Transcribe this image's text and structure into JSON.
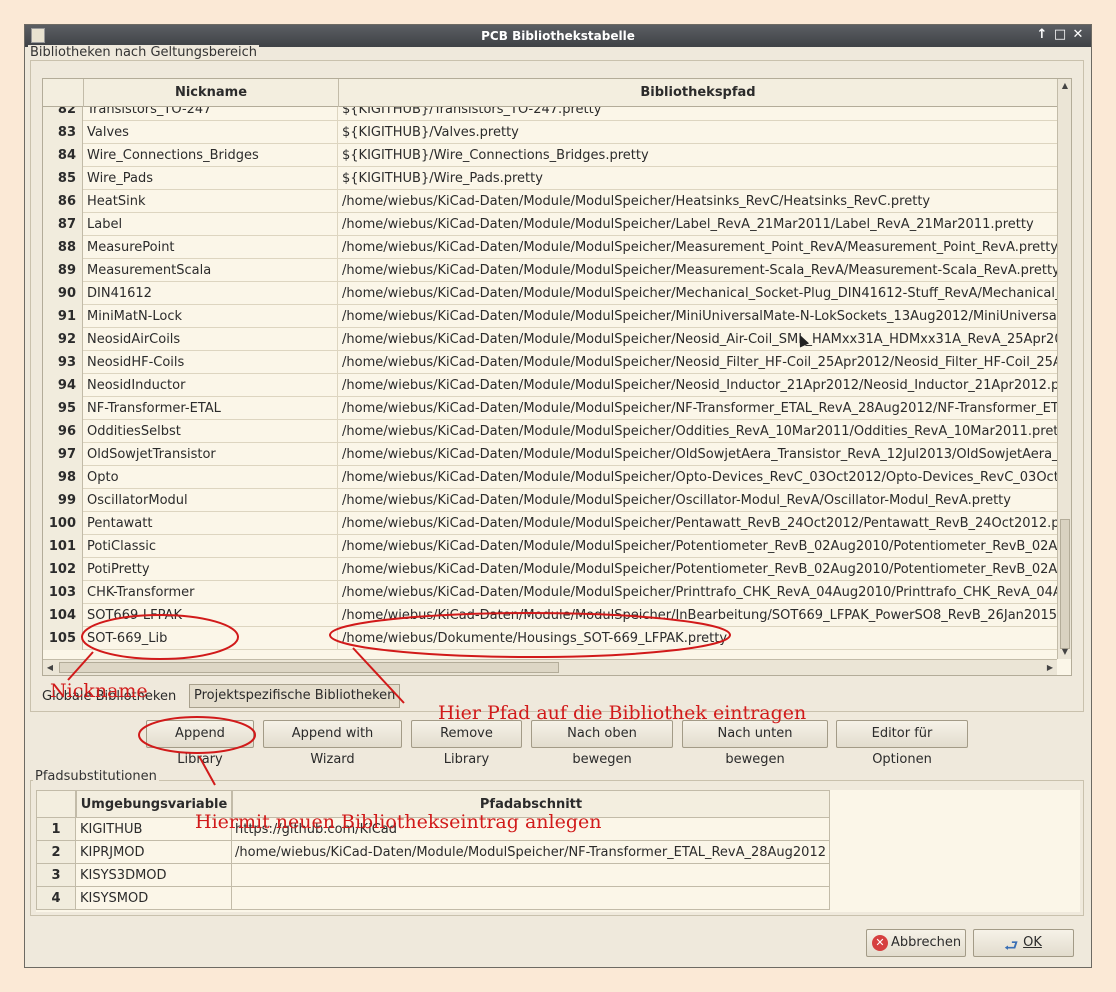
{
  "window": {
    "title": "PCB Bibliothekstabelle"
  },
  "groups": {
    "scope": "Bibliotheken nach Geltungsbereich",
    "substitutions": "Pfadsubstitutionen"
  },
  "lib_table": {
    "columns": [
      "Nickname",
      "Bibliothekspfad"
    ],
    "partial_row": {
      "num": "82",
      "nick": "Transistors_TO-247",
      "path": "${KIGITHUB}/Transistors_TO-247.pretty"
    },
    "rows": [
      {
        "num": "83",
        "nick": "Valves",
        "path": "${KIGITHUB}/Valves.pretty"
      },
      {
        "num": "84",
        "nick": "Wire_Connections_Bridges",
        "path": "${KIGITHUB}/Wire_Connections_Bridges.pretty"
      },
      {
        "num": "85",
        "nick": "Wire_Pads",
        "path": "${KIGITHUB}/Wire_Pads.pretty"
      },
      {
        "num": "86",
        "nick": "HeatSink",
        "path": "/home/wiebus/KiCad-Daten/Module/ModulSpeicher/Heatsinks_RevC/Heatsinks_RevC.pretty"
      },
      {
        "num": "87",
        "nick": "Label",
        "path": "/home/wiebus/KiCad-Daten/Module/ModulSpeicher/Label_RevA_21Mar2011/Label_RevA_21Mar2011.pretty"
      },
      {
        "num": "88",
        "nick": "MeasurePoint",
        "path": "/home/wiebus/KiCad-Daten/Module/ModulSpeicher/Measurement_Point_RevA/Measurement_Point_RevA.pretty"
      },
      {
        "num": "89",
        "nick": "MeasurementScala",
        "path": "/home/wiebus/KiCad-Daten/Module/ModulSpeicher/Measurement-Scala_RevA/Measurement-Scala_RevA.pretty"
      },
      {
        "num": "90",
        "nick": "DIN41612",
        "path": "/home/wiebus/KiCad-Daten/Module/ModulSpeicher/Mechanical_Socket-Plug_DIN41612-Stuff_RevA/Mechanical_"
      },
      {
        "num": "91",
        "nick": "MiniMatN-Lock",
        "path": "/home/wiebus/KiCad-Daten/Module/ModulSpeicher/MiniUniversalMate-N-LokSockets_13Aug2012/MiniUniversal"
      },
      {
        "num": "92",
        "nick": "NeosidAirCoils",
        "path": "/home/wiebus/KiCad-Daten/Module/ModulSpeicher/Neosid_Air-Coil_SML_HAMxx31A_HDMxx31A_RevA_25Apr20"
      },
      {
        "num": "93",
        "nick": "NeosidHF-Coils",
        "path": "/home/wiebus/KiCad-Daten/Module/ModulSpeicher/Neosid_Filter_HF-Coil_25Apr2012/Neosid_Filter_HF-Coil_25A"
      },
      {
        "num": "94",
        "nick": "NeosidInductor",
        "path": "/home/wiebus/KiCad-Daten/Module/ModulSpeicher/Neosid_Inductor_21Apr2012/Neosid_Inductor_21Apr2012.pr"
      },
      {
        "num": "95",
        "nick": "NF-Transformer-ETAL",
        "path": "/home/wiebus/KiCad-Daten/Module/ModulSpeicher/NF-Transformer_ETAL_RevA_28Aug2012/NF-Transformer_ETA"
      },
      {
        "num": "96",
        "nick": "OdditiesSelbst",
        "path": "/home/wiebus/KiCad-Daten/Module/ModulSpeicher/Oddities_RevA_10Mar2011/Oddities_RevA_10Mar2011.prett"
      },
      {
        "num": "97",
        "nick": "OldSowjetTransistor",
        "path": "/home/wiebus/KiCad-Daten/Module/ModulSpeicher/OldSowjetAera_Transistor_RevA_12Jul2013/OldSowjetAera_T"
      },
      {
        "num": "98",
        "nick": "Opto",
        "path": "/home/wiebus/KiCad-Daten/Module/ModulSpeicher/Opto-Devices_RevC_03Oct2012/Opto-Devices_RevC_03Oct2"
      },
      {
        "num": "99",
        "nick": "OscillatorModul",
        "path": "/home/wiebus/KiCad-Daten/Module/ModulSpeicher/Oscillator-Modul_RevA/Oscillator-Modul_RevA.pretty"
      },
      {
        "num": "100",
        "nick": "Pentawatt",
        "path": "/home/wiebus/KiCad-Daten/Module/ModulSpeicher/Pentawatt_RevB_24Oct2012/Pentawatt_RevB_24Oct2012.pr"
      },
      {
        "num": "101",
        "nick": "PotiClassic",
        "path": "/home/wiebus/KiCad-Daten/Module/ModulSpeicher/Potentiometer_RevB_02Aug2010/Potentiometer_RevB_02Au"
      },
      {
        "num": "102",
        "nick": "PotiPretty",
        "path": "/home/wiebus/KiCad-Daten/Module/ModulSpeicher/Potentiometer_RevB_02Aug2010/Potentiometer_RevB_02Au"
      },
      {
        "num": "103",
        "nick": "CHK-Transformer",
        "path": "/home/wiebus/KiCad-Daten/Module/ModulSpeicher/Printtrafo_CHK_RevA_04Aug2010/Printtrafo_CHK_RevA_04A"
      },
      {
        "num": "104",
        "nick": "SOT669-LFPAK",
        "path": "/home/wiebus/KiCad-Daten/Module/ModulSpeicher/InBearbeitung/SOT669_LFPAK_PowerSO8_RevB_26Jan2015/S"
      },
      {
        "num": "105",
        "nick": "SOT-669_Lib",
        "path": "/home/wiebus/Dokumente/Housings_SOT-669_LFPAK.pretty"
      }
    ]
  },
  "tabs": {
    "global": "Globale Bibliotheken",
    "project": "Projektspezifische Bibliotheken"
  },
  "buttons": {
    "append": "Append Library",
    "append_wizard": "Append with Wizard",
    "remove": "Remove Library",
    "move_up": "Nach oben bewegen",
    "move_down": "Nach unten bewegen",
    "options": "Editor für Optionen",
    "cancel": "Abbrechen",
    "ok": "OK"
  },
  "subst_table": {
    "columns": [
      "Umgebungsvariable",
      "Pfadabschnitt"
    ],
    "rows": [
      {
        "num": "1",
        "var": "KIGITHUB",
        "val": "https://github.com/KiCad"
      },
      {
        "num": "2",
        "var": "KIPRJMOD",
        "val": "/home/wiebus/KiCad-Daten/Module/ModulSpeicher/NF-Transformer_ETAL_RevA_28Aug2012"
      },
      {
        "num": "3",
        "var": "KISYS3DMOD",
        "val": ""
      },
      {
        "num": "4",
        "var": "KISYSMOD",
        "val": ""
      }
    ]
  },
  "annotations": {
    "nickname": "Nickname",
    "path_hint": "Hier Pfad auf die Bibliothek eintragen",
    "append_hint": "Hiermit neuen Bibliothekseintrag anlegen"
  },
  "colors": {
    "annotation": "#d11a1a",
    "titlebar": "#4a4d52"
  }
}
